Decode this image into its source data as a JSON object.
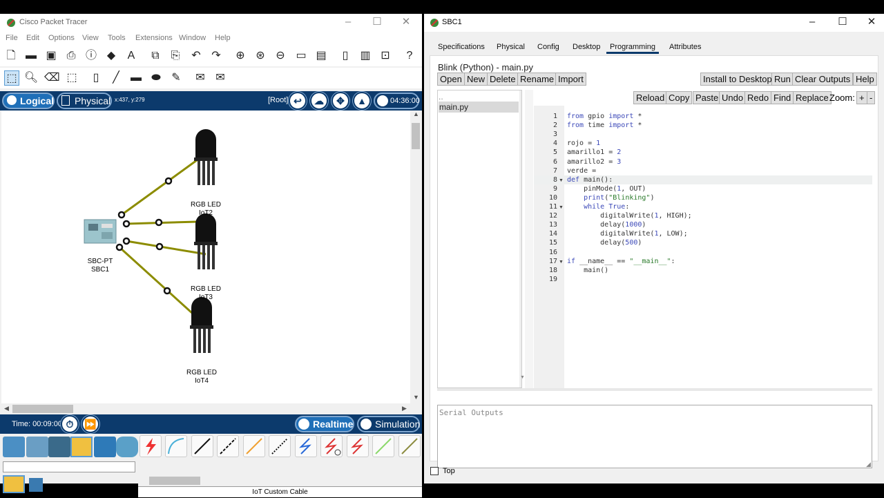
{
  "left_window": {
    "title": "Cisco Packet Tracer",
    "menu": [
      "File",
      "Edit",
      "Options",
      "View",
      "Tools",
      "Extensions",
      "Window",
      "Help"
    ],
    "logical_label": "Logical",
    "physical_label": "Physical",
    "coords": "x:437, y:279",
    "root_label": "[Root]",
    "clock": "04:36:00",
    "time_label": "Time: 00:09:00",
    "realtime_label": "Realtime",
    "simulation_label": "Simulation",
    "cable_label": "IoT Custom Cable",
    "devices": [
      {
        "type": "RGB LED",
        "name": "IoT2"
      },
      {
        "type": "RGB LED",
        "name": "IoT3"
      },
      {
        "type": "RGB LED",
        "name": "IoT4"
      },
      {
        "type": "SBC-PT",
        "name": "SBC1"
      }
    ]
  },
  "right_window": {
    "title": "SBC1",
    "tabs": [
      "Specifications",
      "Physical",
      "Config",
      "Desktop",
      "Programming",
      "Attributes"
    ],
    "active_tab": "Programming",
    "project_title": "Blink (Python) - main.py",
    "left_buttons": [
      "Open",
      "New",
      "Delete",
      "Rename",
      "Import"
    ],
    "right_buttons": [
      "Install to Desktop",
      "Run",
      "Clear Outputs",
      "Help"
    ],
    "file_list": [
      "..",
      "main.py"
    ],
    "editor_buttons": [
      "Reload",
      "Copy",
      "Paste",
      "Undo",
      "Redo",
      "Find",
      "Replace"
    ],
    "zoom_label": "Zoom:",
    "zoom_in": "+",
    "zoom_out": "-",
    "code_lines": [
      "from gpio import *",
      "from time import *",
      "",
      "rojo = 1",
      "amarillo1 = 2",
      "amarillo2 = 3",
      "verde =",
      "def main():",
      "    pinMode(1, OUT)",
      "    print(\"Blinking\")",
      "    while True:",
      "        digitalWrite(1, HIGH);",
      "        delay(1000)",
      "        digitalWrite(1, LOW);",
      "        delay(500)",
      "",
      "if __name__ == \"__main__\":",
      "    main()",
      ""
    ],
    "serial_placeholder": "Serial Outputs",
    "top_checkbox_label": "Top"
  },
  "colors": {
    "pt_blue": "#0c3a6c",
    "link_olive": "#8c8c00",
    "active_tab_underline": "#0c3a6c"
  }
}
